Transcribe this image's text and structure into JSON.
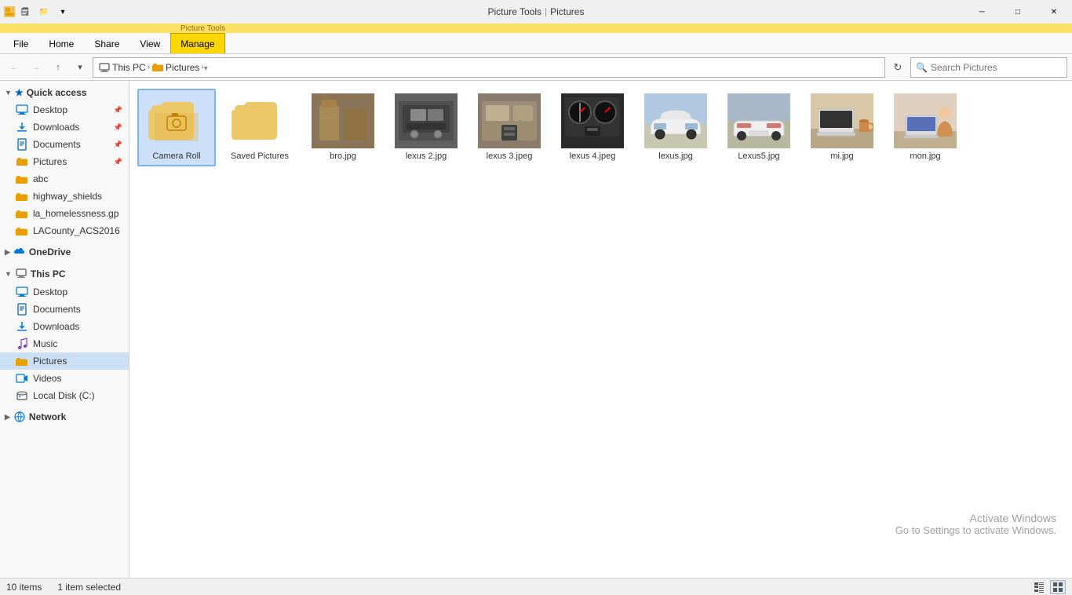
{
  "titleBar": {
    "pictureTools": "Picture Tools",
    "pictures": "Pictures"
  },
  "tabs": {
    "file": "File",
    "home": "Home",
    "share": "Share",
    "view": "View",
    "manage": "Manage"
  },
  "addressBar": {
    "thisPc": "This PC",
    "pictures": "Pictures",
    "searchPlaceholder": "Search Pictures",
    "refreshTitle": "Refresh"
  },
  "sidebar": {
    "quickAccess": "Quick access",
    "desktop": "Desktop",
    "downloads": "Downloads",
    "documents": "Documents",
    "pictures": "Pictures",
    "pinnedItems": [
      "abc",
      "highway_shields",
      "la_homelessness.gp",
      "LACounty_ACS2016"
    ],
    "oneDrive": "OneDrive",
    "thisPC": "This PC",
    "thisPCItems": [
      "Desktop",
      "Documents",
      "Downloads",
      "Music",
      "Pictures",
      "Videos",
      "Local Disk (C:)"
    ],
    "network": "Network"
  },
  "files": [
    {
      "name": "Camera Roll",
      "type": "folder",
      "selected": true
    },
    {
      "name": "Saved Pictures",
      "type": "folder",
      "selected": false
    },
    {
      "name": "bro.jpg",
      "type": "image",
      "selected": false
    },
    {
      "name": "lexus 2.jpg",
      "type": "image",
      "selected": false
    },
    {
      "name": "lexus 3.jpeg",
      "type": "image",
      "selected": false
    },
    {
      "name": "lexus 4.jpeg",
      "type": "image",
      "selected": false
    },
    {
      "name": "lexus.jpg",
      "type": "image",
      "selected": false
    },
    {
      "name": "Lexus5.jpg",
      "type": "image",
      "selected": false
    },
    {
      "name": "mi.jpg",
      "type": "image",
      "selected": false
    },
    {
      "name": "mon.jpg",
      "type": "image",
      "selected": false
    }
  ],
  "statusBar": {
    "itemCount": "10 items",
    "selectedCount": "1 item selected"
  },
  "watermark": {
    "line1": "Activate Windows",
    "line2": "Go to Settings to activate Windows."
  },
  "windowControls": {
    "minimize": "─",
    "maximize": "□",
    "close": "✕"
  }
}
